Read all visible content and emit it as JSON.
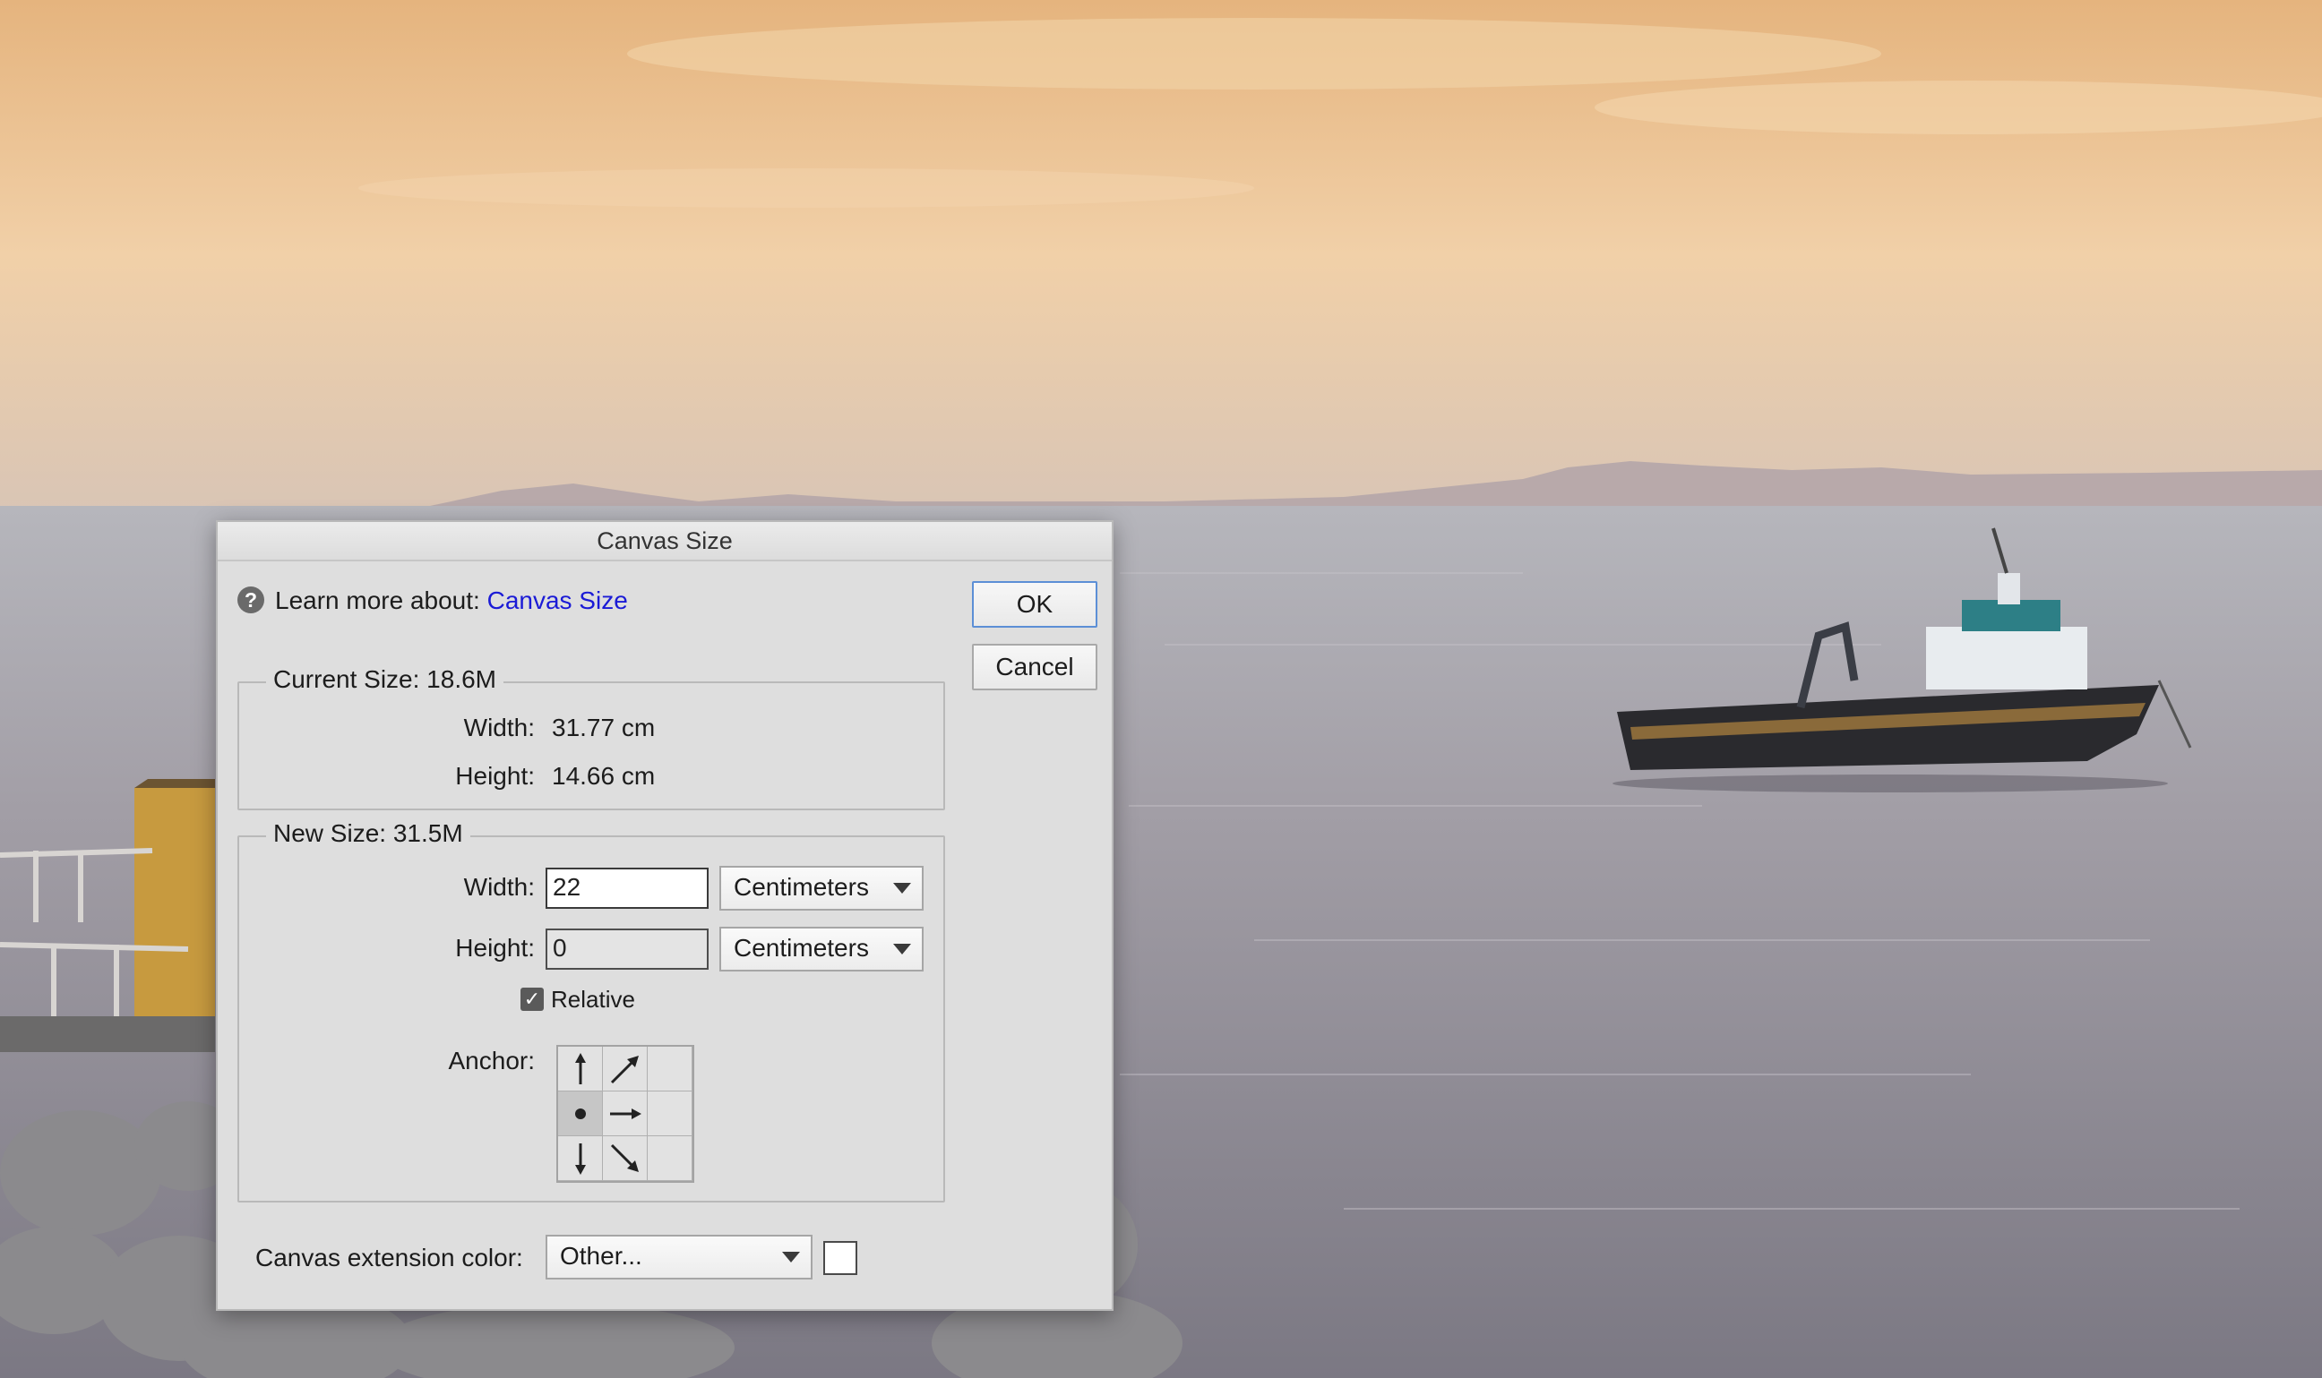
{
  "dialog": {
    "title": "Canvas Size",
    "help": {
      "prefix": "Learn more about:",
      "link": "Canvas Size"
    },
    "buttons": {
      "ok": "OK",
      "cancel": "Cancel"
    },
    "current_size": {
      "legend": "Current Size: 18.6M",
      "width_label": "Width:",
      "width_value": "31.77 cm",
      "height_label": "Height:",
      "height_value": "14.66 cm"
    },
    "new_size": {
      "legend": "New Size: 31.5M",
      "width_label": "Width:",
      "width_value": "22",
      "width_unit": "Centimeters",
      "height_label": "Height:",
      "height_value": "0",
      "height_unit": "Centimeters",
      "relative_label": "Relative",
      "relative_checked": true,
      "anchor_label": "Anchor:",
      "anchor_selected": "middle-left"
    },
    "extension_color": {
      "label": "Canvas extension color:",
      "value": "Other...",
      "swatch_color": "#ffffff"
    }
  },
  "colors": {
    "link": "#1b1bd6",
    "dialog_bg": "#dedede",
    "ok_border": "#5c8fd6"
  }
}
